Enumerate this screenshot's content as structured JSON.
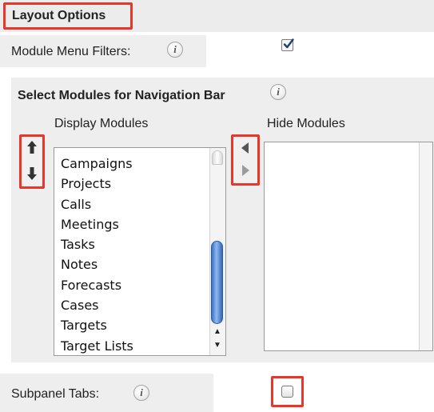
{
  "layout_options": {
    "title": "Layout Options"
  },
  "module_menu_filters": {
    "label": "Module Menu Filters:",
    "info": "i",
    "checked": true
  },
  "navigation": {
    "title": "Select Modules for Navigation Bar",
    "info": "i",
    "display_header": "Display Modules",
    "hide_header": "Hide Modules",
    "display_modules": [
      "Campaigns",
      "Projects",
      "Calls",
      "Meetings",
      "Tasks",
      "Notes",
      "Forecasts",
      "Cases",
      "Targets",
      "Target Lists"
    ],
    "hide_modules": []
  },
  "subpanel_tabs": {
    "label": "Subpanel Tabs:",
    "info": "i",
    "checked": false
  },
  "colors": {
    "highlight": "#e8362a",
    "panel": "#eeeeee",
    "scroll_thumb": "#3b72c4"
  },
  "icons": [
    "arrow-up-icon",
    "arrow-down-icon",
    "arrow-left-icon",
    "arrow-right-icon",
    "info-icon",
    "checkmark-icon"
  ]
}
